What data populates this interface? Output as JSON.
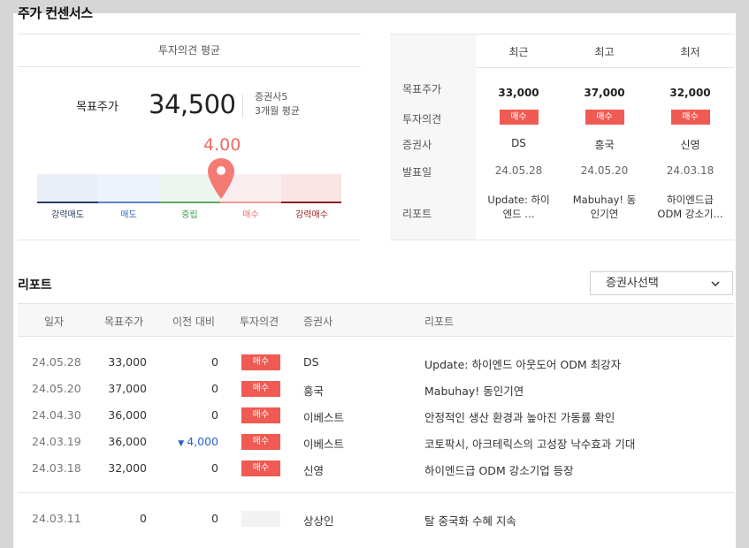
{
  "page_title": "주가 컨센서스",
  "consensus": {
    "header": "투자의견 평균",
    "target_label": "목표주가",
    "target_value": "34,500",
    "broker_count": "증권사5",
    "period": "3개월 평균",
    "score": "4.00",
    "score_value": 4.0,
    "gauge_labels": [
      "강력매도",
      "매도",
      "중립",
      "매수",
      "강력매수"
    ]
  },
  "recent": {
    "columns": [
      "최근",
      "최고",
      "최저"
    ],
    "row_labels": [
      "목표주가",
      "투자의견",
      "증권사",
      "발표일",
      "리포트"
    ],
    "items": [
      {
        "price": "33,000",
        "opinion": "매수",
        "broker": "DS",
        "date": "24.05.28",
        "report": "Update: 하이엔드 ..."
      },
      {
        "price": "37,000",
        "opinion": "매수",
        "broker": "흥국",
        "date": "24.05.20",
        "report": "Mabuhay! 동인기연"
      },
      {
        "price": "32,000",
        "opinion": "매수",
        "broker": "신영",
        "date": "24.03.18",
        "report": "하이엔드급 ODM 강소기..."
      }
    ]
  },
  "reports": {
    "title": "리포트",
    "select_label": "증권사선택",
    "headers": [
      "일자",
      "목표주가",
      "이전 대비",
      "투자의견",
      "증권사",
      "리포트"
    ],
    "rows": [
      {
        "date": "24.05.28",
        "target": "33,000",
        "change": "0",
        "opinion": "매수",
        "broker": "DS",
        "title": "Update: 하이엔드 아웃도어 ODM 최강자"
      },
      {
        "date": "24.05.20",
        "target": "37,000",
        "change": "0",
        "opinion": "매수",
        "broker": "흥국",
        "title": "Mabuhay! 동인기연"
      },
      {
        "date": "24.04.30",
        "target": "36,000",
        "change": "0",
        "opinion": "매수",
        "broker": "이베스트",
        "title": "안정적인 생산 환경과 높아진 가동률 확인"
      },
      {
        "date": "24.03.19",
        "target": "36,000",
        "change": "4,000",
        "opinion": "매수",
        "broker": "이베스트",
        "title": "코토팍시, 아크테릭스의 고성장 낙수효과 기대"
      },
      {
        "date": "24.03.18",
        "target": "32,000",
        "change": "0",
        "opinion": "매수",
        "broker": "신영",
        "title": "하이엔드급 ODM 강소기업 등장"
      },
      {
        "date": "24.03.11",
        "target": "0",
        "change": "0",
        "opinion": "",
        "broker": "상상인",
        "title": "탈 중국화 수혜 지속"
      }
    ]
  },
  "colors": {
    "accent": "#ef5a52",
    "score": "#f06a63",
    "down": "#2a5fd0"
  }
}
